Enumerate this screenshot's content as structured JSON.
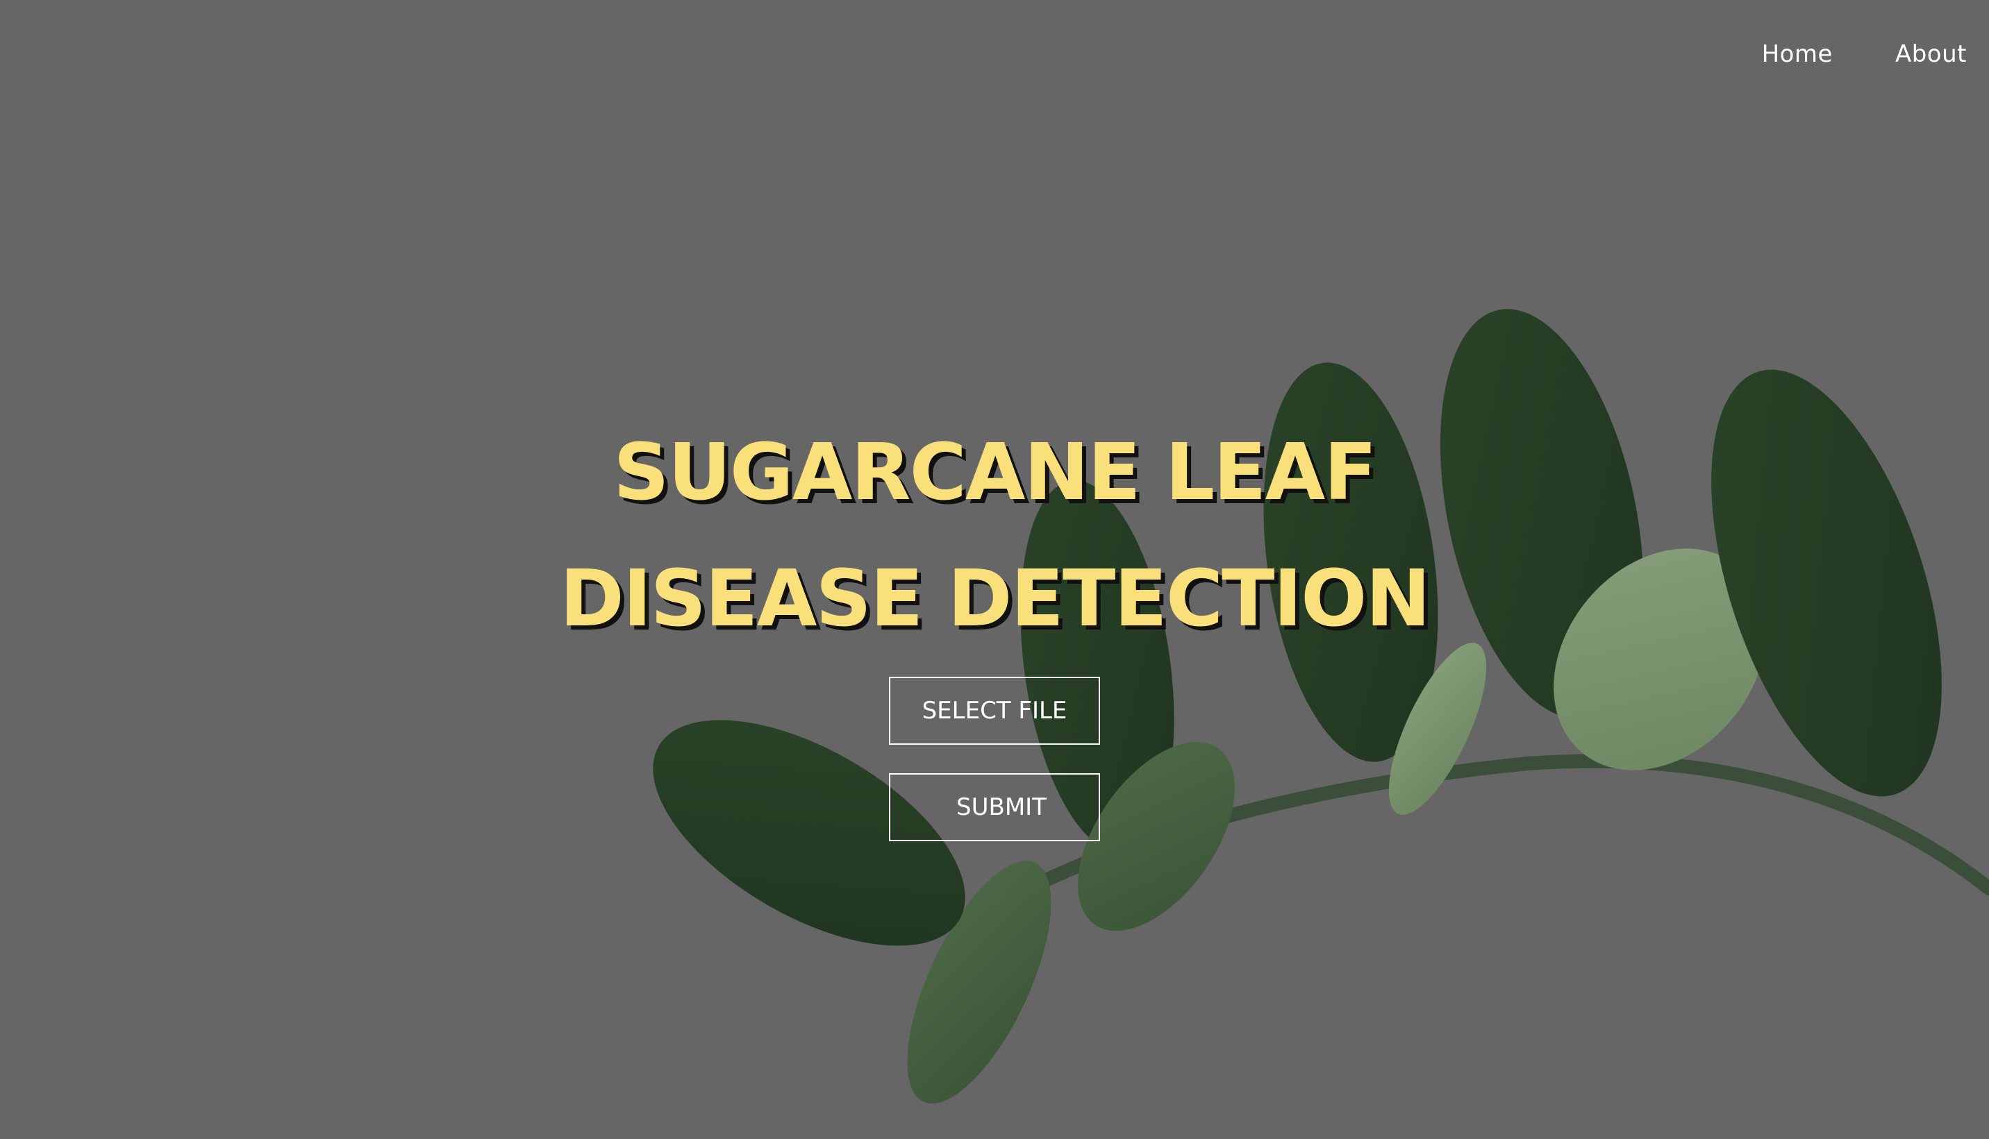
{
  "nav": {
    "home_label": "Home",
    "about_label": "About"
  },
  "hero": {
    "title_line1": "SUGARCANE LEAF",
    "title_line2": "DISEASE DETECTION"
  },
  "actions": {
    "select_file_label": "SELECT FILE",
    "submit_label": "SUBMIT"
  },
  "colors": {
    "background": "#666666",
    "title": "#f9e07a",
    "leaf_dark": "#2f4a2c",
    "leaf_light": "#6f8a63",
    "stem": "#3b4e39"
  },
  "icons": {
    "background_image": "leaf-branch-photo"
  }
}
